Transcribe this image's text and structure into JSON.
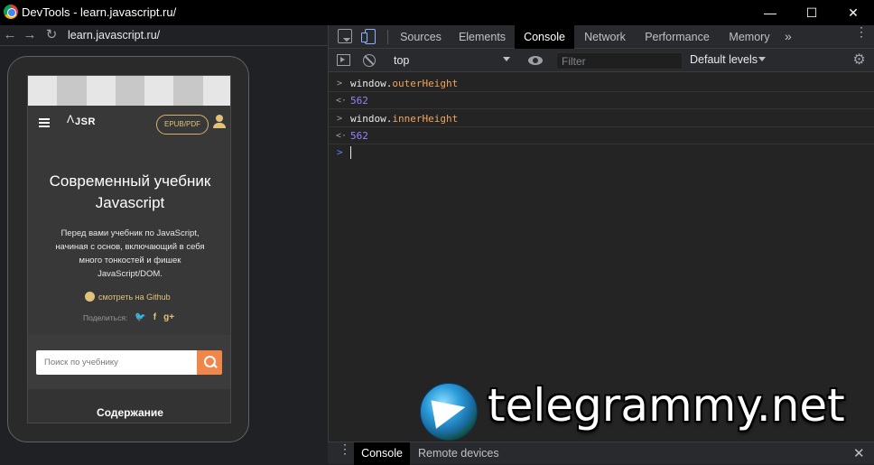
{
  "window": {
    "title": "DevTools - learn.javascript.ru/",
    "minimize": "—",
    "maximize": "☐",
    "close": "✕"
  },
  "device_pane": {
    "back": "←",
    "forward": "→",
    "reload": "↻",
    "url": "learn.javascript.ru/"
  },
  "site": {
    "logo": "JSR",
    "epub_button": "EPUB/PDF",
    "title": "Современный учебник Javascript",
    "description": "Перед вами учебник по JavaScript, начиная с основ, включающий в себя много тонкостей и фишек JavaScript/DOM.",
    "github_link": "смотреть на Github",
    "share_label": "Поделиться:",
    "share_icons": [
      "twitter-icon",
      "facebook-icon",
      "google-plus-icon"
    ],
    "share_glyphs": [
      "🐦",
      "f",
      "g+"
    ],
    "search_placeholder": "Поиск по учебнику",
    "contents_heading": "Содержание"
  },
  "devtools": {
    "tabs": [
      "Sources",
      "Elements",
      "Console",
      "Network",
      "Performance",
      "Memory"
    ],
    "active_tab": "Console",
    "more_tabs": "»",
    "kebab": "⋮",
    "context": "top",
    "filter_placeholder": "Filter",
    "levels": "Default levels",
    "console": [
      {
        "type": "input",
        "object": "window.",
        "property": "outerHeight"
      },
      {
        "type": "output",
        "value": "562"
      },
      {
        "type": "input",
        "object": "window.",
        "property": "innerHeight"
      },
      {
        "type": "output",
        "value": "562"
      }
    ],
    "prompt": ">"
  },
  "drawer": {
    "tabs": [
      "Console",
      "Remote devices"
    ],
    "active": "Console",
    "close": "✕",
    "kebab": "⋮"
  },
  "watermark": {
    "text": "telegrammy.net"
  },
  "colors": {
    "accent": "#8ab4f8",
    "site_gold": "#e0c27a",
    "search_orange": "#f0874a",
    "console_number": "#9980ff",
    "console_property": "#f0a45d"
  }
}
